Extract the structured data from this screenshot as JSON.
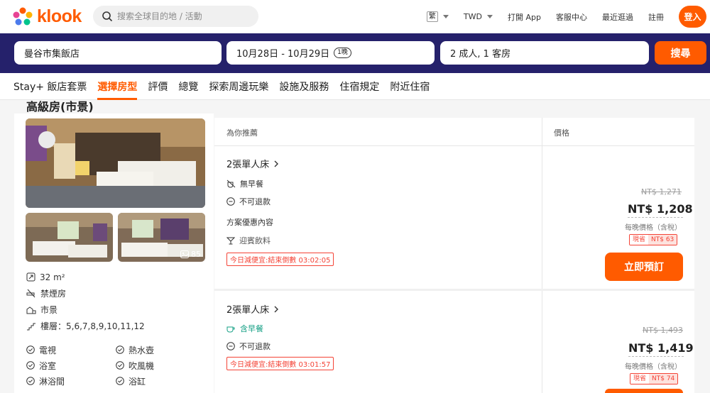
{
  "header": {
    "logo_text": "klook",
    "search_placeholder": "搜索全球目的地 / 活動",
    "lang_badge": "繁",
    "currency": "TWD",
    "open_app": "打開 App",
    "help_center": "客服中心",
    "recently_viewed": "最近逛過",
    "register": "註冊",
    "login": "登入"
  },
  "booking": {
    "hotel": "曼谷市集飯店",
    "dates": "10月28日 - 10月29日",
    "nights": "1晚",
    "guests": "2 成人, 1 客房",
    "search_button": "搜尋"
  },
  "tabs": [
    {
      "label": "Stay+ 飯店套票",
      "active": false
    },
    {
      "label": "選擇房型",
      "active": true
    },
    {
      "label": "評價",
      "active": false
    },
    {
      "label": "總覽",
      "active": false
    },
    {
      "label": "探索周邊玩樂",
      "active": false
    },
    {
      "label": "設施及服務",
      "active": false
    },
    {
      "label": "住宿規定",
      "active": false
    },
    {
      "label": "附近住宿",
      "active": false
    }
  ],
  "room": {
    "title": "高級房(市景)",
    "photo_count": "85",
    "size": "32 m²",
    "smoking": "禁煙房",
    "view": "市景",
    "floors": "樓層：5,6,7,8,9,10,11,12",
    "amenities_left": [
      "電視",
      "浴室",
      "淋浴間"
    ],
    "amenities_right": [
      "熱水壺",
      "吹風機",
      "浴缸"
    ]
  },
  "plans_header": {
    "recommend": "為你推薦",
    "price": "價格"
  },
  "plans": [
    {
      "name": "2張單人床",
      "meal": "無早餐",
      "refund": "不可退款",
      "perks_title": "方案優惠內容",
      "perk": "迎賓飲料",
      "promo": "今日減便宜:結束倒數 03:02:05",
      "orig_price": "NT$ 1,271",
      "price": "NT$ 1,208",
      "price_note": "每晚價格（含稅）",
      "save_label": "現省",
      "save_amount": "NT$ 63",
      "book": "立即預訂"
    },
    {
      "name": "2張單人床",
      "meal": "含早餐",
      "refund": "不可退款",
      "promo": "今日減便宜:結束倒數 03:01:57",
      "orig_price": "NT$ 1,493",
      "price": "NT$ 1,419",
      "price_note": "每晚價格（含稅）",
      "save_label": "現省",
      "save_amount": "NT$ 74"
    }
  ],
  "colors": {
    "brand": "#ff5b00",
    "navy": "#25216b",
    "promo_red": "#f44336",
    "green": "#16a085"
  }
}
